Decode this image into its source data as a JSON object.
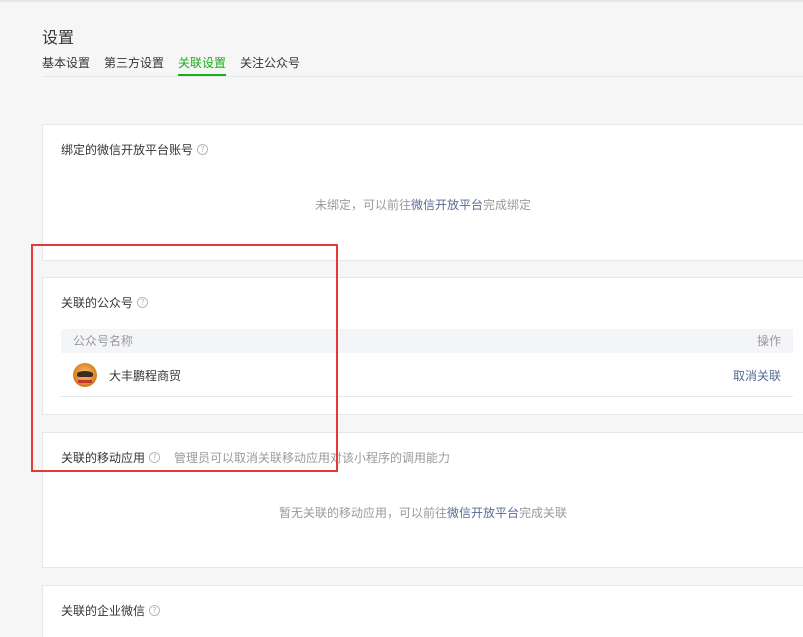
{
  "page": {
    "title": "设置"
  },
  "tabs": [
    {
      "label": "基本设置"
    },
    {
      "label": "第三方设置"
    },
    {
      "label": "关联设置",
      "active": true
    },
    {
      "label": "关注公众号"
    }
  ],
  "open_platform": {
    "title": "绑定的微信开放平台账号",
    "empty_prefix": "未绑定，可以前往",
    "empty_link": "微信开放平台",
    "empty_suffix": "完成绑定"
  },
  "official_accounts": {
    "title": "关联的公众号",
    "columns": {
      "name": "公众号名称",
      "action": "操作"
    },
    "rows": [
      {
        "name": "大丰鹏程商贸",
        "action": "取消关联"
      }
    ]
  },
  "mobile_apps": {
    "title": "关联的移动应用",
    "note": "管理员可以取消关联移动应用对该小程序的调用能力",
    "empty_prefix": "暂无关联的移动应用，可以前往",
    "empty_link": "微信开放平台",
    "empty_suffix": "完成关联"
  },
  "work_wechat": {
    "title": "关联的企业微信"
  },
  "icons": {
    "help": "?"
  },
  "colors": {
    "accent": "#1aad19",
    "link": "#576b95",
    "highlight": "#e53935"
  }
}
